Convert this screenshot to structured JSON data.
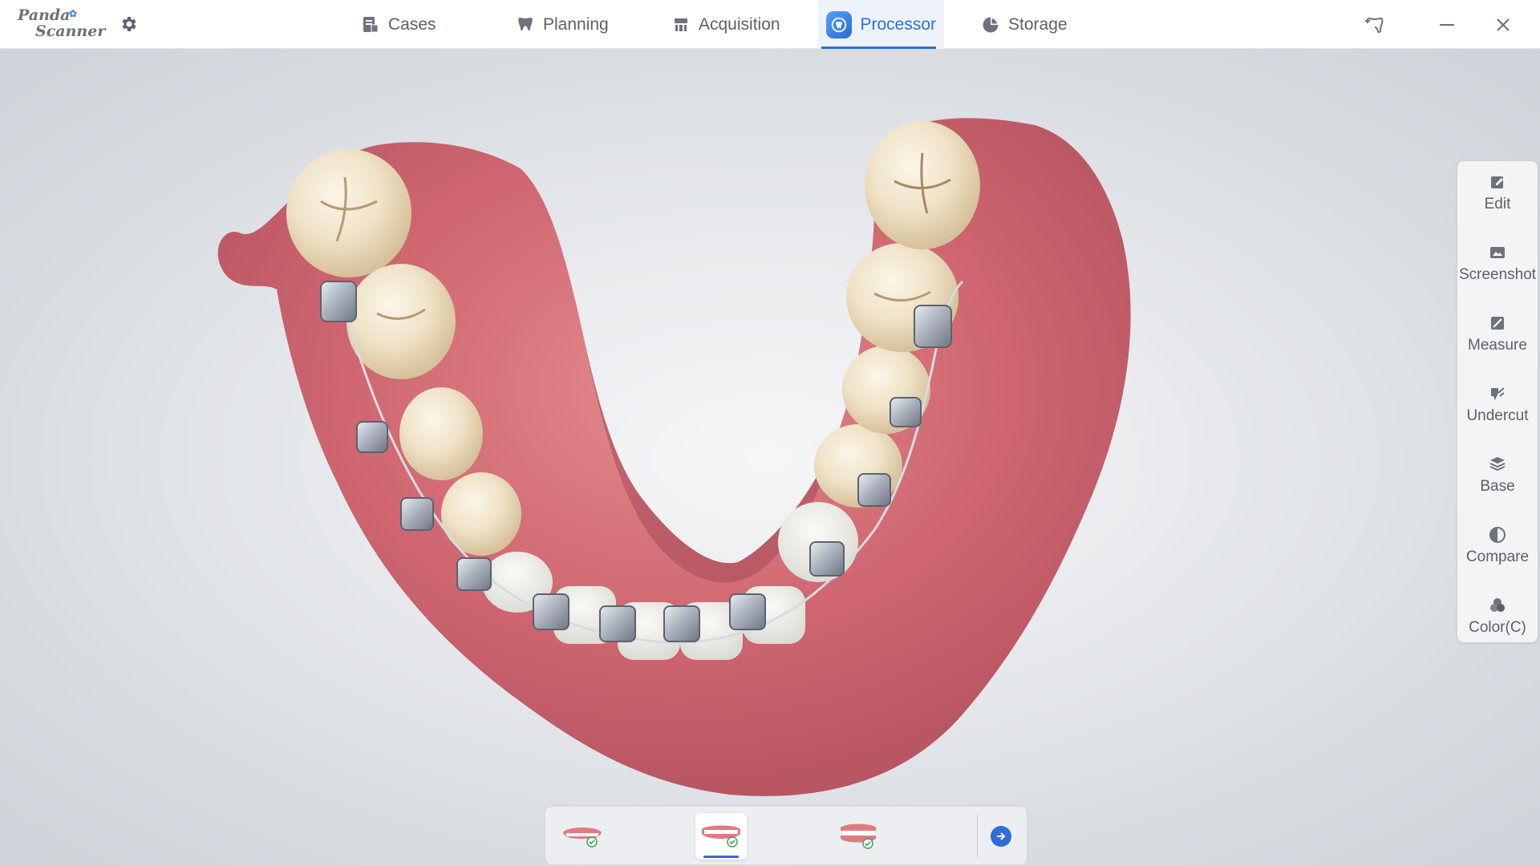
{
  "app": {
    "logo_line1": "Panda",
    "logo_line2": "Scanner"
  },
  "nav": {
    "tabs": [
      {
        "label": "Cases",
        "icon": "cases-icon"
      },
      {
        "label": "Planning",
        "icon": "planning-icon"
      },
      {
        "label": "Acquisition",
        "icon": "acquisition-icon"
      },
      {
        "label": "Processor",
        "icon": "processor-icon",
        "active": true
      },
      {
        "label": "Storage",
        "icon": "storage-icon"
      }
    ]
  },
  "tools": [
    {
      "label": "Edit",
      "icon": "edit-icon"
    },
    {
      "label": "Screenshot",
      "icon": "screenshot-icon"
    },
    {
      "label": "Measure",
      "icon": "measure-icon"
    },
    {
      "label": "Undercut",
      "icon": "undercut-icon"
    },
    {
      "label": "Base",
      "icon": "base-icon"
    },
    {
      "label": "Compare",
      "icon": "compare-icon"
    },
    {
      "label": "Color(C)",
      "icon": "color-icon"
    }
  ],
  "jaw_selector": {
    "items": [
      {
        "name": "upper-jaw",
        "icon": "upper-jaw-icon",
        "checked": true
      },
      {
        "name": "lower-jaw",
        "icon": "lower-jaw-icon",
        "checked": true,
        "active": true
      },
      {
        "name": "bite",
        "icon": "bite-icon",
        "checked": true
      }
    ]
  },
  "colors": {
    "accent": "#2f6fd6",
    "gum": "#d9727a",
    "tooth": "#efe6d4",
    "bracket": "#b9bfc8"
  }
}
